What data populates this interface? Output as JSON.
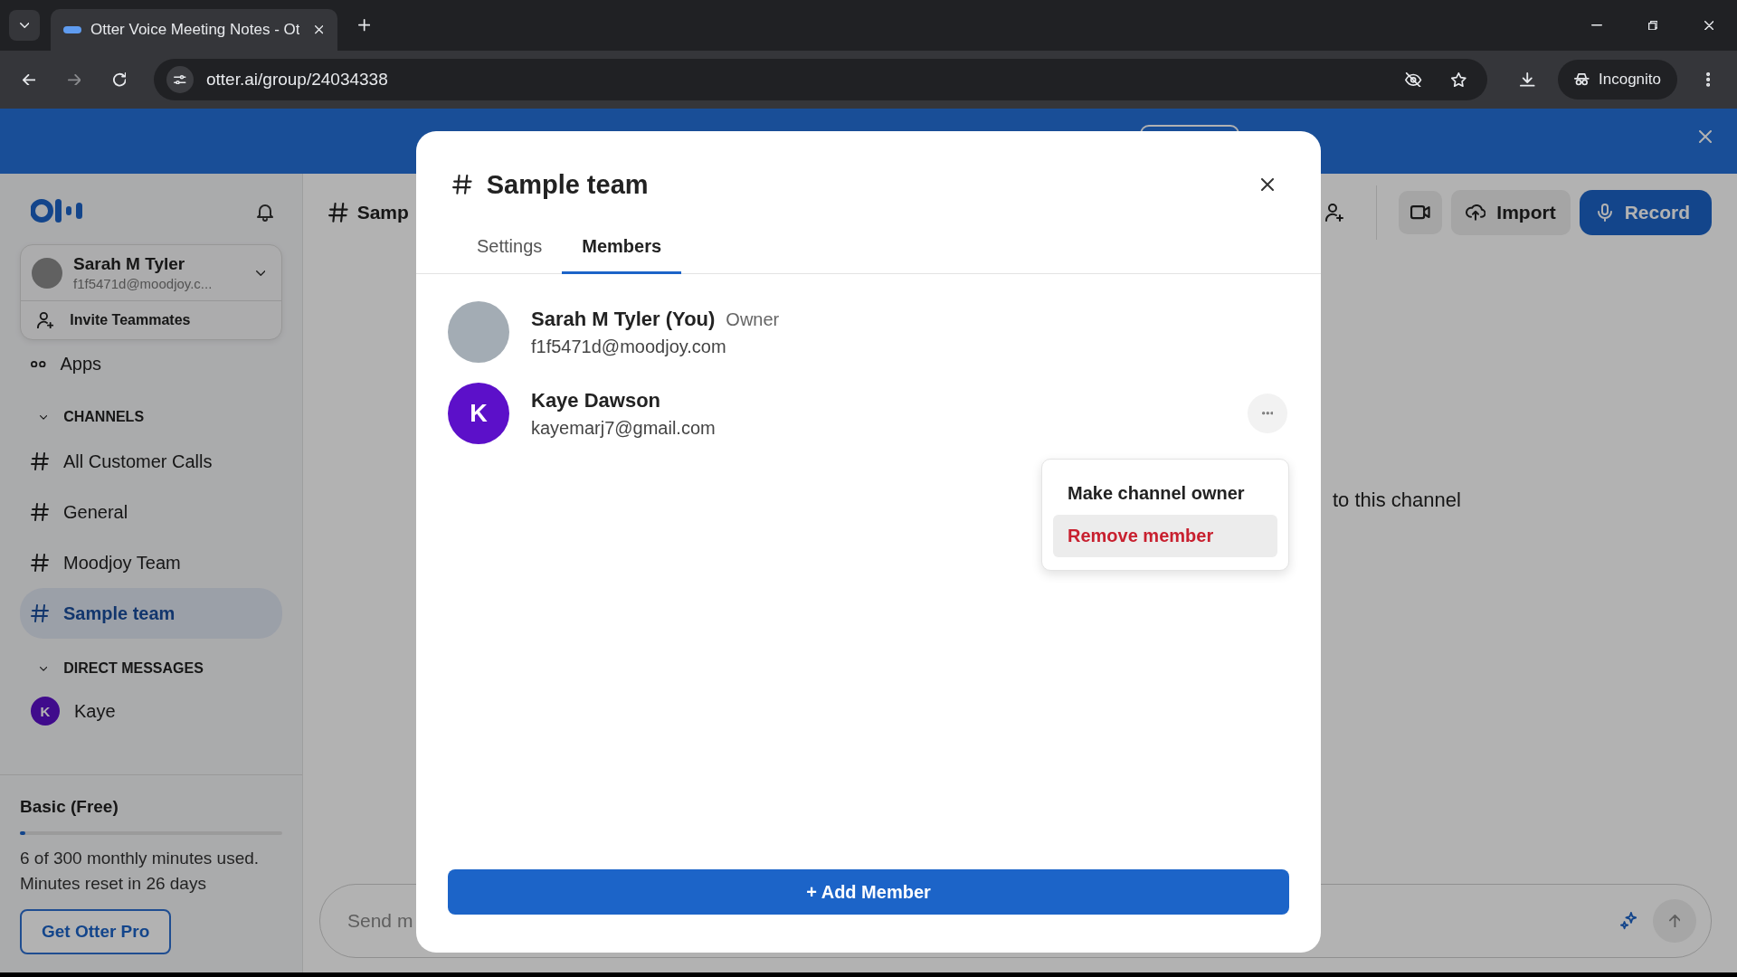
{
  "browser": {
    "tab_title": "Otter Voice Meeting Notes - Ot",
    "url": "otter.ai/group/24034338",
    "incognito_label": "Incognito"
  },
  "sidebar": {
    "account": {
      "name": "Sarah M Tyler",
      "email": "f1f5471d@moodjoy.c...",
      "invite_label": "Invite Teammates"
    },
    "apps_label": "Apps",
    "channels_heading": "CHANNELS",
    "channels": [
      {
        "name": "All Customer Calls",
        "selected": false
      },
      {
        "name": "General",
        "selected": false
      },
      {
        "name": "Moodjoy Team",
        "selected": false
      },
      {
        "name": "Sample team",
        "selected": true
      }
    ],
    "dm_heading": "DIRECT MESSAGES",
    "direct_messages": [
      {
        "name": "Kaye",
        "initial": "K"
      }
    ],
    "plan": {
      "name": "Basic (Free)",
      "level": 0.02,
      "usage": "6 of 300 monthly minutes used.",
      "reset": "Minutes reset in 26 days",
      "upgrade_button": "Get Otter Pro"
    }
  },
  "main": {
    "channel_title": "Samp",
    "import_button": "Import",
    "record_button": "Record",
    "empty_text": "to this channel",
    "message_placeholder": "Send m"
  },
  "modal": {
    "title": "Sample team",
    "tabs": [
      {
        "label": "Settings",
        "selected": false
      },
      {
        "label": "Members",
        "selected": true
      }
    ],
    "members": [
      {
        "name": "Sarah M Tyler (You)",
        "role": "Owner",
        "email": "f1f5471d@moodjoy.com",
        "kind": "photo",
        "menu_open": false
      },
      {
        "name": "Kaye Dawson",
        "email": "kayemarj7@gmail.com",
        "kind": "initial",
        "initial": "K",
        "menu_open": true
      }
    ],
    "member_menu": [
      {
        "label": "Make channel owner",
        "kind": "normal",
        "hovered": false
      },
      {
        "label": "Remove member",
        "kind": "danger",
        "hovered": true
      }
    ],
    "add_button": "+ Add Member"
  }
}
